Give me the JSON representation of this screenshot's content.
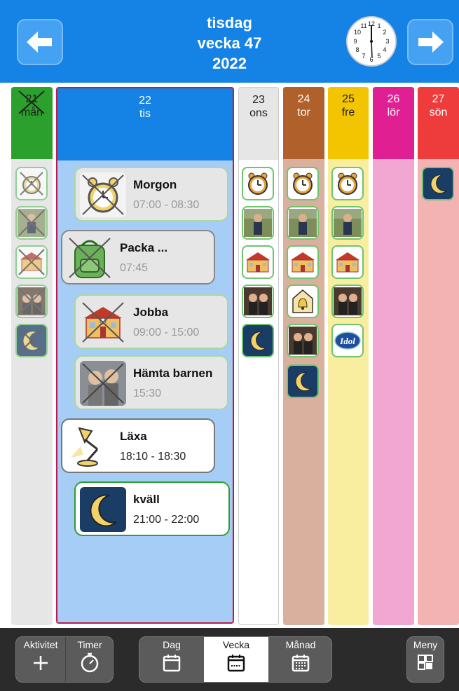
{
  "header": {
    "day": "tisdag",
    "week": "vecka 47",
    "year": "2022"
  },
  "clock": {
    "numbers": [
      "12",
      "1",
      "2",
      "3",
      "4",
      "5",
      "6",
      "7",
      "8",
      "9",
      "10",
      "11"
    ]
  },
  "columns": [
    {
      "num": "21",
      "day": "mån",
      "color": "#2ca02c",
      "bg": "#e6e6e6"
    },
    {
      "num": "22",
      "day": "tis",
      "color": "#1582e6",
      "bg": "#a6cdf5"
    },
    {
      "num": "23",
      "day": "ons",
      "color": "#e6e6e6",
      "bg": "#ffffff"
    },
    {
      "num": "24",
      "day": "tor",
      "color": "#b0602a",
      "bg": "#d9b09e"
    },
    {
      "num": "25",
      "day": "fre",
      "color": "#f2c500",
      "bg": "#f9eea0"
    },
    {
      "num": "26",
      "day": "lör",
      "color": "#e01f93",
      "bg": "#f2a6d2"
    },
    {
      "num": "27",
      "day": "sön",
      "color": "#ee3c3c",
      "bg": "#f4b3b3"
    }
  ],
  "activities": [
    {
      "title": "Morgon",
      "time": "07:00 - 08:30",
      "icon": "alarm-clock-icon"
    },
    {
      "title": "Packa ...",
      "time": "07:45",
      "icon": "backpack-icon"
    },
    {
      "title": "Jobba",
      "time": "09:00 - 15:00",
      "icon": "school-building-icon"
    },
    {
      "title": "Hämta barnen",
      "time": "15:30",
      "icon": "children-photo"
    },
    {
      "title": "Läxa",
      "time": "18:10 - 18:30",
      "icon": "desk-lamp-icon"
    },
    {
      "title": "kväll",
      "time": "21:00 - 22:00",
      "icon": "moon-icon"
    }
  ],
  "mini_events": {
    "mon": [
      "alarm-clock-icon",
      "person-photo",
      "school-building-icon",
      "children-photo",
      "moon-icon"
    ],
    "wed": [
      "alarm-clock-icon",
      "person-photo",
      "school-building-icon",
      "children-photo",
      "moon-icon"
    ],
    "thu": [
      "alarm-clock-icon",
      "person-photo",
      "school-building-icon",
      "bell-icon",
      "children-photo",
      "moon-icon"
    ],
    "fri": [
      "alarm-clock-icon",
      "person-photo",
      "school-building-icon",
      "children-photo",
      "idol-logo"
    ],
    "sun": [
      "moon-icon"
    ]
  },
  "idol_text": "Idol",
  "toolbar": {
    "aktivitet": "Aktivitet",
    "timer": "Timer",
    "dag": "Dag",
    "vecka": "Vecka",
    "manad": "Månad",
    "meny": "Meny"
  }
}
